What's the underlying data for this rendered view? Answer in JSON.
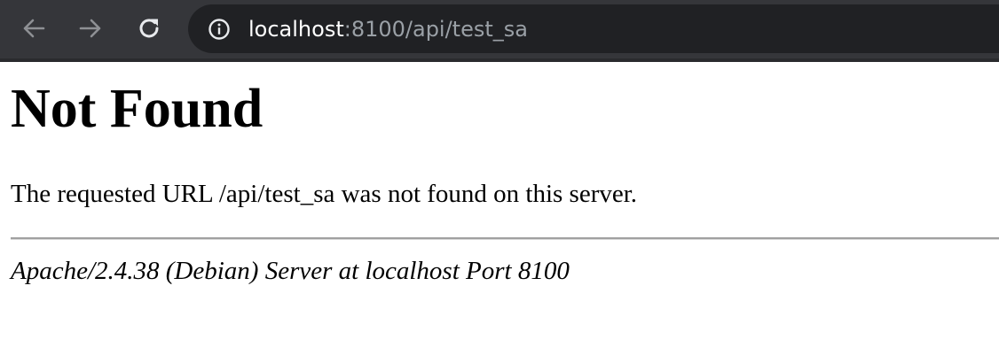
{
  "browser": {
    "url_host": "localhost",
    "url_rest": ":8100/api/test_sa",
    "icons": {
      "back": "arrow-left-icon",
      "forward": "arrow-right-icon",
      "reload": "reload-icon",
      "site_info": "info-icon"
    },
    "colors": {
      "toolbar_bg": "#35363a",
      "omnibox_bg": "#202124",
      "url_host": "#ffffff",
      "url_rest": "#9aa0a6"
    }
  },
  "page": {
    "heading": "Not Found",
    "message": "The requested URL /api/test_sa was not found on this server.",
    "server_signature": "Apache/2.4.38 (Debian) Server at localhost Port 8100"
  }
}
